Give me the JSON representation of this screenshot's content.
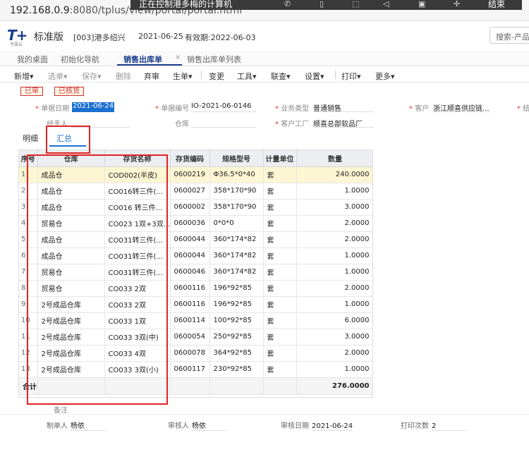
{
  "browser": {
    "url_host": "192.168.0.9",
    "url_rest": ":8080/tplus/view/portal/portal.html",
    "remote_title": "正在控制港多梅的计算机",
    "remote_end": "结束"
  },
  "header": {
    "logo": "T+",
    "logo_sub": "专属云",
    "edition": "标准版",
    "company": "[003]港多绍兴",
    "date": "2021-06-25",
    "valid": "有效期:2022-06-03",
    "search_placeholder": "搜索-产品"
  },
  "tabs": [
    {
      "label": "我的桌面"
    },
    {
      "label": "初始化导航"
    },
    {
      "label": "销售出库单"
    },
    {
      "label": "销售出库单列表"
    }
  ],
  "tab_close": "×",
  "toolbar": [
    "新增▾",
    "选单▾",
    "保存▾",
    "删除",
    "弃审",
    "生单▾",
    "变更",
    "工具▾",
    "联查▾",
    "设置▾",
    "打印▾",
    "更多▾"
  ],
  "badges": [
    "已审",
    "已核货"
  ],
  "form": {
    "doc_date_label": "单据日期",
    "doc_date": "2021-06-24",
    "doc_no_label": "单据编号",
    "doc_no": "IO-2021-06-0146",
    "biz_type_label": "业务类型",
    "biz_type": "普通销售",
    "customer_label": "客户",
    "customer": "浙江顺喜供应链...",
    "settle_label": "结",
    "handler_label": "经手人",
    "warehouse_label": "仓库",
    "factory_label": "客户工厂",
    "factory": "顺喜总部软品厂"
  },
  "subtabs": [
    "明细",
    "汇总"
  ],
  "table": {
    "columns": [
      "序号",
      "仓库",
      "存货名称",
      "存货编码",
      "规格型号",
      "计量单位",
      "数量"
    ],
    "rows": [
      [
        "1",
        "成品仓",
        "COD002(半皮)",
        "0600219",
        "Φ36.5*0*40",
        "套",
        "240.0000"
      ],
      [
        "2",
        "成品仓",
        "CO016转三件(...",
        "0600027",
        "358*170*90",
        "套",
        "1.0000"
      ],
      [
        "3",
        "成品仓",
        "CO016 转三件...",
        "0600002",
        "358*170*90",
        "套",
        "3.0000"
      ],
      [
        "4",
        "贸易仓",
        "CO023 1双+3双...",
        "0600036",
        "0*0*0",
        "套",
        "2.0000"
      ],
      [
        "5",
        "成品仓",
        "CO031转三件(...",
        "0600044",
        "360*174*82",
        "套",
        "2.0000"
      ],
      [
        "6",
        "成品仓",
        "CO031转三件(...",
        "0600044",
        "360*174*82",
        "套",
        "1.0000"
      ],
      [
        "7",
        "贸易仓",
        "CO031转三件(...",
        "0600046",
        "360*174*82",
        "套",
        "1.0000"
      ],
      [
        "8",
        "贸易仓",
        "CO033 2双",
        "0600116",
        "196*92*85",
        "套",
        "2.0000"
      ],
      [
        "9",
        "2号成品仓库",
        "CO033 2双",
        "0600116",
        "196*92*85",
        "套",
        "1.0000"
      ],
      [
        "10",
        "2号成品仓库",
        "CO033 1双",
        "0600114",
        "100*92*85",
        "套",
        "6.0000"
      ],
      [
        "11",
        "2号成品仓库",
        "CO033 3双(中)",
        "0600054",
        "250*92*85",
        "套",
        "3.0000"
      ],
      [
        "12",
        "2号成品仓库",
        "CO033 4双",
        "0600078",
        "364*92*85",
        "套",
        "2.0000"
      ],
      [
        "13",
        "2号成品仓库",
        "CO033 3双(小)",
        "0600117",
        "230*92*85",
        "套",
        "1.0000"
      ]
    ],
    "total_label": "合计",
    "total_value": "276.0000"
  },
  "footer": {
    "remark_label": "备注",
    "maker_label": "制单人",
    "maker": "杨依",
    "auditor_label": "审核人",
    "auditor": "杨依",
    "audit_date_label": "审核日期",
    "audit_date": "2021-06-24",
    "print_count_label": "打印次数",
    "print_count": "2"
  },
  "colors": {
    "brand": "#1a3c8c",
    "selection": "#1a6fd1",
    "annotation_red": "#e02424",
    "highlight_row": "#fdf6d3"
  }
}
